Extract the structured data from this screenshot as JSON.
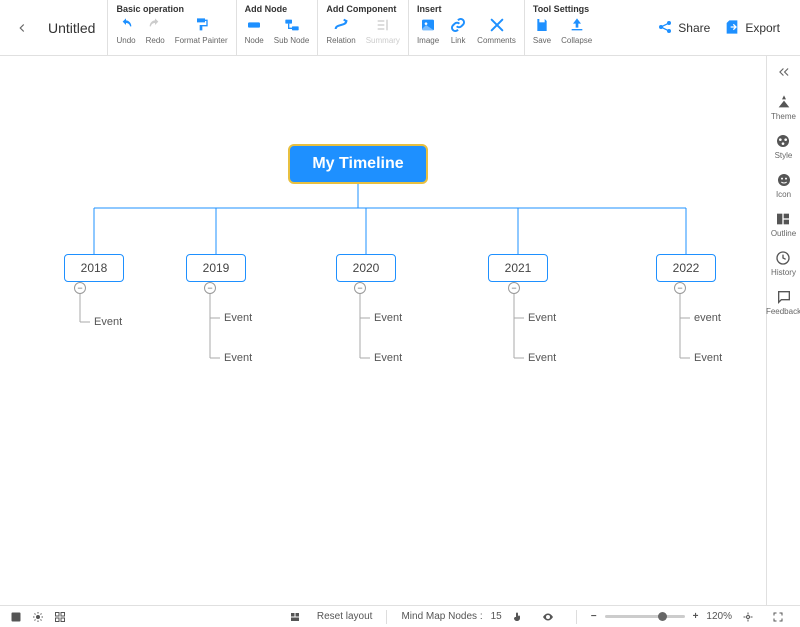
{
  "header": {
    "title": "Untitled",
    "groups": {
      "basic": {
        "label": "Basic operation",
        "undo": "Undo",
        "redo": "Redo",
        "format": "Format Painter"
      },
      "addnode": {
        "label": "Add Node",
        "node": "Node",
        "subnode": "Sub Node"
      },
      "addcomp": {
        "label": "Add Component",
        "relation": "Relation",
        "summary": "Summary"
      },
      "insert": {
        "label": "Insert",
        "image": "Image",
        "link": "Link",
        "comments": "Comments"
      },
      "tools": {
        "label": "Tool Settings",
        "save": "Save",
        "collapse": "Collapse"
      }
    },
    "share": "Share",
    "export": "Export"
  },
  "sidebar": {
    "theme": "Theme",
    "style": "Style",
    "icon": "Icon",
    "outline": "Outline",
    "history": "History",
    "feedback": "Feedback"
  },
  "map": {
    "root": "My Timeline",
    "years": [
      {
        "label": "2018",
        "events": [
          "Event"
        ]
      },
      {
        "label": "2019",
        "events": [
          "Event",
          "Event"
        ]
      },
      {
        "label": "2020",
        "events": [
          "Event",
          "Event"
        ]
      },
      {
        "label": "2021",
        "events": [
          "Event",
          "Event"
        ]
      },
      {
        "label": "2022",
        "events": [
          "event",
          "Event"
        ]
      }
    ]
  },
  "bottom": {
    "reset": "Reset layout",
    "nodes_label": "Mind Map Nodes :",
    "nodes_count": "15",
    "zoom": "120%"
  }
}
